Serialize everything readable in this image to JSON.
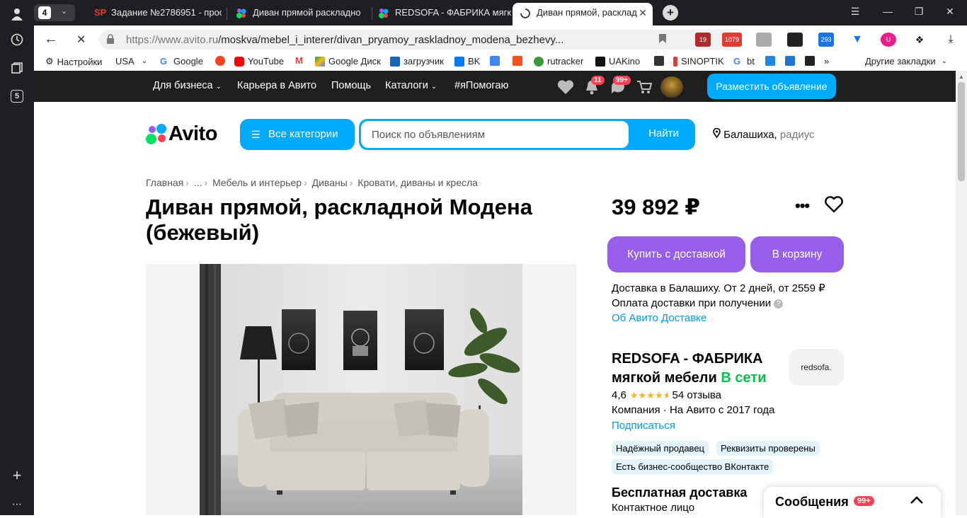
{
  "browser": {
    "tab_count": "4",
    "tabs": [
      {
        "title": "Задание №2786951 - прос"
      },
      {
        "title": "Диван прямой раскладно"
      },
      {
        "title": "REDSOFA - ФАБРИКА мягк"
      },
      {
        "title": "Диван прямой, расклад"
      }
    ],
    "address": {
      "host": "https://www.avito.ru",
      "path": "/moskva/mebel_i_interer/divan_pryamoy_raskladnoy_modena_bezhevy..."
    },
    "extensions": {
      "badge_19": "19",
      "badge_1079": "1079",
      "badge_293": "293"
    },
    "side_badge": "5",
    "bookmarks": [
      "Настройки",
      "USA",
      "Google",
      "YouTube",
      "Google Диск",
      "загрузчик",
      "BK",
      "rutracker",
      "UAKino",
      "SINOPTIK",
      "bt",
      "Другие закладки"
    ],
    "bookmarks_overflow": "»",
    "colors": {
      "frame": "#1f1f23",
      "tab_active": "#ffffff"
    }
  },
  "avito_topbar": {
    "nav": [
      "Для бизнеса",
      "Карьера в Авито",
      "Помощь",
      "Каталоги",
      "#яПомогаю"
    ],
    "notifications_badge": "11",
    "messages_badge": "99+",
    "post_button": "Разместить объявление"
  },
  "header": {
    "logo_text": "Avito",
    "categories_button": "Все категории",
    "search_placeholder": "Поиск по объявлениям",
    "search_button": "Найти",
    "location": "Балашиха,",
    "radius": "радиус"
  },
  "breadcrumbs": [
    "Главная",
    "...",
    "Мебель и интерьер",
    "Диваны",
    "Кровати, диваны и кресла"
  ],
  "listing": {
    "title": "Диван прямой, раскладной Модена (бежевый)",
    "price": "39 892 ₽",
    "buy_button": "Купить с доставкой",
    "cart_button": "В корзину",
    "delivery_line1": "Доставка в Балашиху. От 2 дней, от 2559 ₽",
    "delivery_line2": "Оплата доставки при получении",
    "delivery_link": "Об Авито Доставке"
  },
  "seller": {
    "name": "REDSOFA - ФАБРИКА мягкой мебели",
    "status": "В сети",
    "logo_text": "redsofa.",
    "rating": "4,6",
    "rating_value": 4.6,
    "reviews": "54 отзыва",
    "meta": "Компания · На Авито с 2017 года",
    "subscribe": "Подписаться",
    "badges": [
      "Надёжный продавец",
      "Реквизиты проверены",
      "Есть бизнес-сообщество ВКонтакте"
    ],
    "free_delivery": "Бесплатная доставка",
    "contact": "Контактное лицо"
  },
  "messages_panel": {
    "title": "Сообщения",
    "badge": "99+"
  },
  "theme": {
    "accent": "#00aaff",
    "purple": "#965eeb",
    "online": "#02c54b",
    "link": "#0099f7",
    "badge_red": "#ff4053"
  }
}
